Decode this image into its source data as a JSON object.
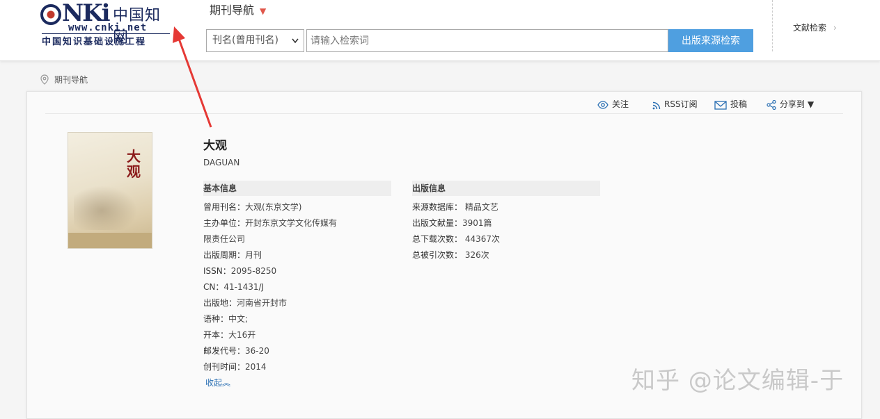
{
  "header": {
    "logo": {
      "brand": "CNKI",
      "cn_name": "中国知网",
      "url": "www.cnki.net",
      "subtitle": "中国知识基础设施工程"
    },
    "nav_dropdown_label": "期刊导航",
    "search": {
      "field_selected": "刊名(曾用刊名)",
      "placeholder": "请输入检索词",
      "button_label": "出版来源检索"
    },
    "literature_search_label": "文献检索"
  },
  "breadcrumb": {
    "label": "期刊导航"
  },
  "toolbar": {
    "follow": "关注",
    "rss": "RSS订阅",
    "submit": "投稿",
    "share": "分享到 ▼"
  },
  "journal": {
    "title": "大观",
    "title_en": "DAGUAN",
    "cover_text_1": "大",
    "cover_text_2": "观",
    "basic_info_heading": "基本信息",
    "basic_info": [
      {
        "label": "曾用刊名：",
        "value": "大观(东京文学)"
      },
      {
        "label": "主办单位：",
        "value": "开封东京文学文化传媒有限责任公司"
      },
      {
        "label": "出版周期：",
        "value": "月刊"
      },
      {
        "label": "ISSN：",
        "value": "2095-8250"
      },
      {
        "label": "CN：",
        "value": "41-1431/J"
      },
      {
        "label": "出版地：",
        "value": "河南省开封市"
      },
      {
        "label": "语种：",
        "value": "中文;"
      },
      {
        "label": "开本：",
        "value": "大16开"
      },
      {
        "label": "邮发代号：",
        "value": "36-20"
      },
      {
        "label": "创刊时间：",
        "value": "2014"
      }
    ],
    "publish_info_heading": "出版信息",
    "publish_info": [
      {
        "label": "来源数据库：",
        "value": " 精品文艺"
      },
      {
        "label": "出版文献量：",
        "value": "3901篇"
      },
      {
        "label": "总下载次数：",
        "value": " 44367次"
      },
      {
        "label": "总被引次数：",
        "value": " 326次"
      }
    ],
    "collapse_label": "收起︽"
  },
  "watermark": "知乎 @论文编辑-于",
  "colors": {
    "search_button": "#4f9fe0",
    "arrow": "#e53935",
    "link": "#2a6fb3",
    "logo_navy": "#1b2a5e"
  }
}
